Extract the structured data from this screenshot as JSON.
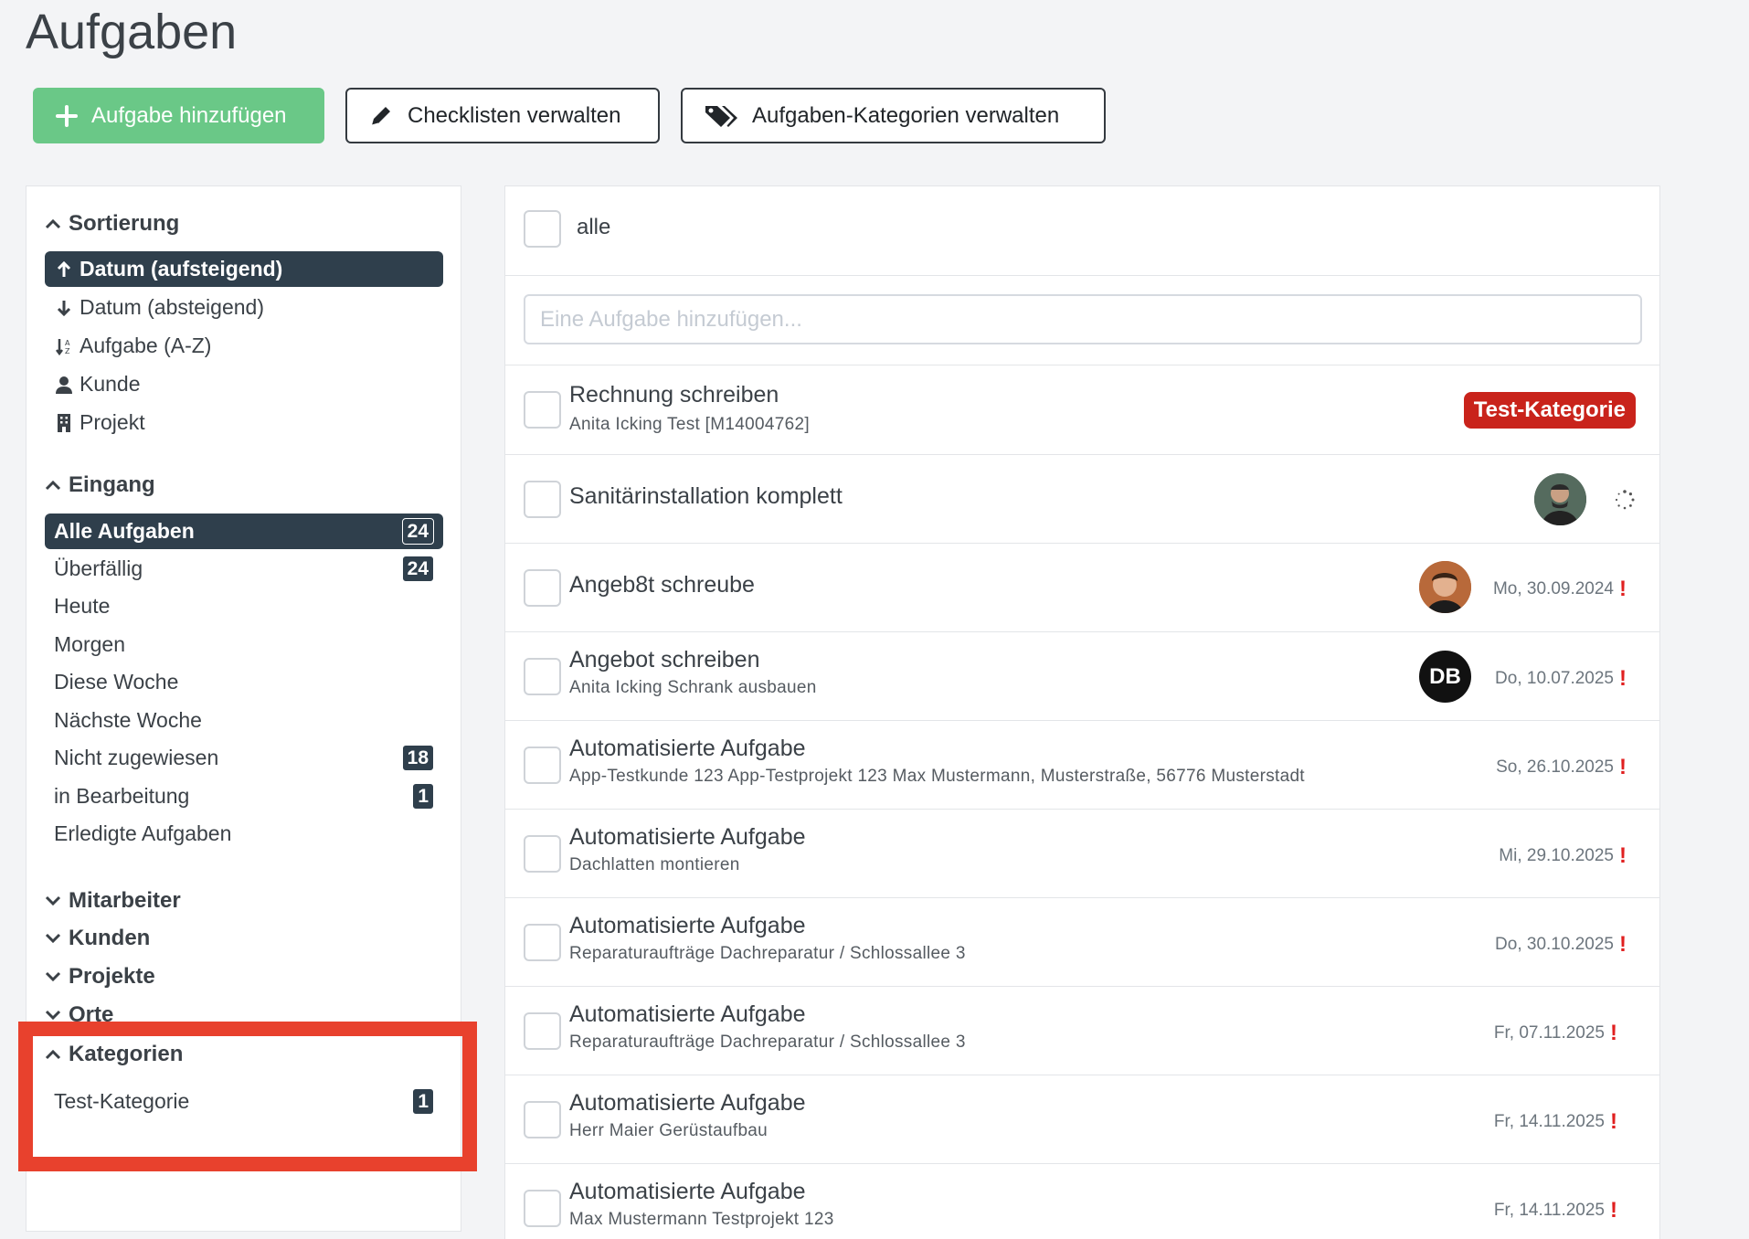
{
  "page": {
    "title": "Aufgaben"
  },
  "toolbar": {
    "add_label": "Aufgabe hinzufügen",
    "checklists_label": "Checklisten verwalten",
    "categories_label": "Aufgaben-Kategorien verwalten"
  },
  "sidebar": {
    "sorting": {
      "heading": "Sortierung",
      "items": [
        {
          "label": "Datum (aufsteigend)",
          "icon": "arrow-up-icon",
          "active": true
        },
        {
          "label": "Datum (absteigend)",
          "icon": "arrow-down-icon",
          "active": false
        },
        {
          "label": "Aufgabe (A-Z)",
          "icon": "sort-alpha-icon",
          "active": false
        },
        {
          "label": "Kunde",
          "icon": "user-icon",
          "active": false
        },
        {
          "label": "Projekt",
          "icon": "building-icon",
          "active": false
        }
      ]
    },
    "inbox": {
      "heading": "Eingang",
      "items": [
        {
          "label": "Alle Aufgaben",
          "count": "24",
          "active": true
        },
        {
          "label": "Überfällig",
          "count": "24"
        },
        {
          "label": "Heute",
          "count": ""
        },
        {
          "label": "Morgen",
          "count": ""
        },
        {
          "label": "Diese Woche",
          "count": ""
        },
        {
          "label": "Nächste Woche",
          "count": ""
        },
        {
          "label": "Nicht zugewiesen",
          "count": "18"
        },
        {
          "label": "in Bearbeitung",
          "count": "1"
        },
        {
          "label": "Erledigte Aufgaben",
          "count": ""
        }
      ]
    },
    "collapsed_sections": [
      "Mitarbeiter",
      "Kunden",
      "Projekte",
      "Orte"
    ],
    "categories": {
      "heading": "Kategorien",
      "items": [
        {
          "label": "Test-Kategorie",
          "count": "1"
        }
      ]
    }
  },
  "main": {
    "select_all_label": "alle",
    "new_task_placeholder": "Eine Aufgabe hinzufügen...",
    "tasks": [
      {
        "title": "Rechnung schreiben",
        "subtitle": "Anita Icking Test [M14004762]",
        "category": "Test-Kategorie",
        "date": ""
      },
      {
        "title": "Sanitärinstallation komplett",
        "subtitle": "",
        "date": ""
      },
      {
        "title": "Angeb8t schreube",
        "subtitle": "",
        "date": "Mo, 30.09.2024"
      },
      {
        "title": "Angebot schreiben",
        "subtitle": "Anita Icking Schrank ausbauen",
        "date": "Do, 10.07.2025",
        "avatar_initials": "DB"
      },
      {
        "title": "Automatisierte Aufgabe",
        "subtitle": "App-Testkunde 123 App-Testprojekt 123 Max Mustermann, Musterstraße, 56776 Musterstadt",
        "date": "So, 26.10.2025"
      },
      {
        "title": "Automatisierte Aufgabe",
        "subtitle": "Dachlatten montieren",
        "date": "Mi, 29.10.2025"
      },
      {
        "title": "Automatisierte Aufgabe",
        "subtitle": "Reparaturaufträge Dachreparatur / Schlossallee 3",
        "date": "Do, 30.10.2025"
      },
      {
        "title": "Automatisierte Aufgabe",
        "subtitle": "Reparaturaufträge Dachreparatur / Schlossallee 3",
        "date": "Fr, 07.11.2025"
      },
      {
        "title": "Automatisierte Aufgabe",
        "subtitle": "Herr Maier Gerüstaufbau",
        "date": "Fr, 14.11.2025"
      },
      {
        "title": "Automatisierte Aufgabe",
        "subtitle": "Max Mustermann Testprojekt 123",
        "date": "Fr, 14.11.2025"
      }
    ],
    "overdue_marker": "!"
  },
  "colors": {
    "primary_dark": "#2f3f4c",
    "add_button": "#6ac887",
    "category_badge": "#c9231b",
    "highlight": "#e8412d"
  }
}
